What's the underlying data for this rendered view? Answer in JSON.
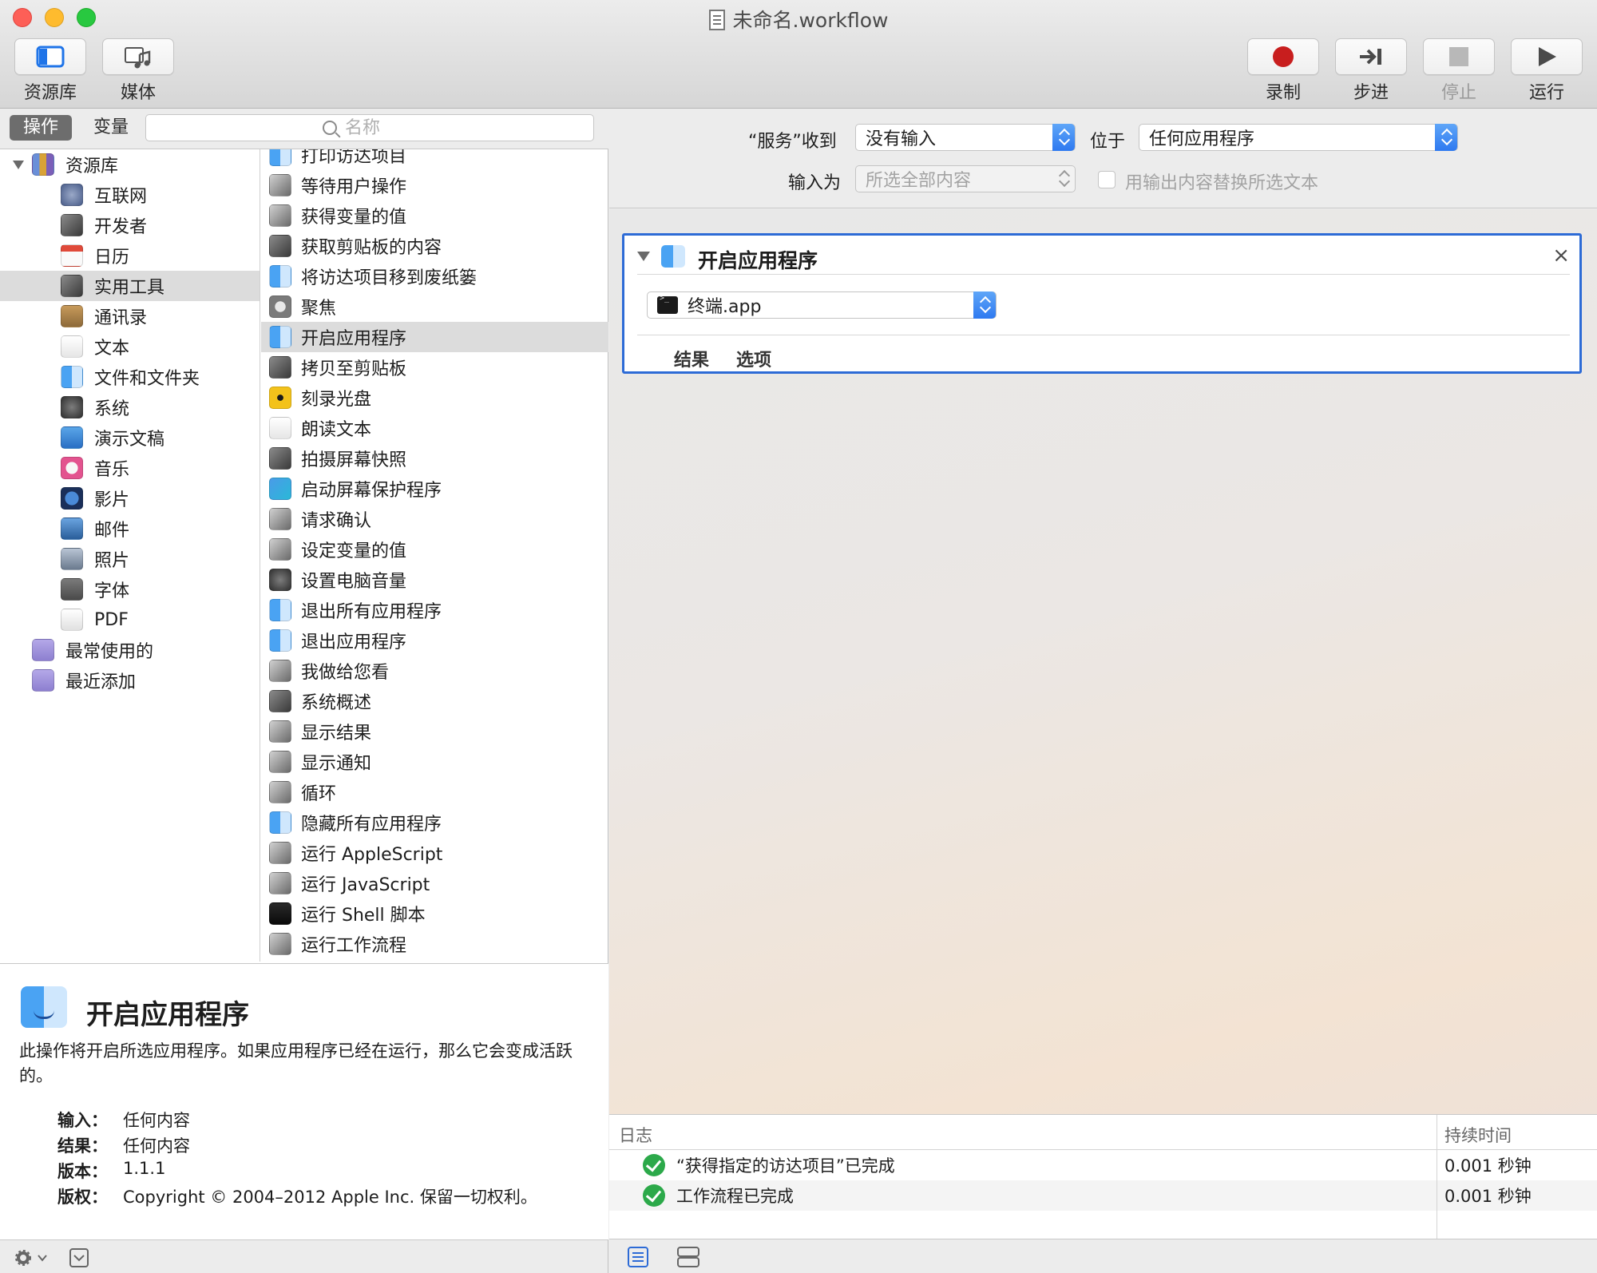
{
  "window": {
    "title": "未命名.workflow"
  },
  "toolbar": {
    "library_label": "资源库",
    "media_label": "媒体",
    "record_label": "录制",
    "step_label": "步进",
    "stop_label": "停止",
    "run_label": "运行"
  },
  "library": {
    "tab_actions": "操作",
    "tab_variables": "变量",
    "search_placeholder": "名称",
    "categories": [
      {
        "label": "资源库",
        "icon": "library-icon"
      },
      {
        "label": "互联网",
        "icon": "globe-icon"
      },
      {
        "label": "开发者",
        "icon": "tools-icon"
      },
      {
        "label": "日历",
        "icon": "calendar-icon"
      },
      {
        "label": "实用工具",
        "icon": "tools-icon"
      },
      {
        "label": "通讯录",
        "icon": "contacts-icon"
      },
      {
        "label": "文本",
        "icon": "text-icon"
      },
      {
        "label": "文件和文件夹",
        "icon": "finder-icon"
      },
      {
        "label": "系统",
        "icon": "system-icon"
      },
      {
        "label": "演示文稿",
        "icon": "keynote-icon"
      },
      {
        "label": "音乐",
        "icon": "music-icon"
      },
      {
        "label": "影片",
        "icon": "quicktime-icon"
      },
      {
        "label": "邮件",
        "icon": "mail-icon"
      },
      {
        "label": "照片",
        "icon": "photos-icon"
      },
      {
        "label": "字体",
        "icon": "font-icon"
      },
      {
        "label": "PDF",
        "icon": "pdf-icon"
      },
      {
        "label": "最常使用的",
        "icon": "smart-folder-icon"
      },
      {
        "label": "最近添加",
        "icon": "smart-folder-icon"
      }
    ],
    "actions": [
      {
        "label": "打印访达项目",
        "icon": "finder-icon"
      },
      {
        "label": "等待用户操作",
        "icon": "automator-icon"
      },
      {
        "label": "获得变量的值",
        "icon": "automator-icon"
      },
      {
        "label": "获取剪贴板的内容",
        "icon": "tools-icon"
      },
      {
        "label": "将访达项目移到废纸篓",
        "icon": "finder-icon"
      },
      {
        "label": "聚焦",
        "icon": "spotlight-icon"
      },
      {
        "label": "开启应用程序",
        "icon": "finder-icon"
      },
      {
        "label": "拷贝至剪贴板",
        "icon": "tools-icon"
      },
      {
        "label": "刻录光盘",
        "icon": "burn-icon"
      },
      {
        "label": "朗读文本",
        "icon": "text-icon"
      },
      {
        "label": "拍摄屏幕快照",
        "icon": "tools-icon"
      },
      {
        "label": "启动屏幕保护程序",
        "icon": "screensaver-icon"
      },
      {
        "label": "请求确认",
        "icon": "automator-icon"
      },
      {
        "label": "设定变量的值",
        "icon": "automator-icon"
      },
      {
        "label": "设置电脑音量",
        "icon": "system-icon"
      },
      {
        "label": "退出所有应用程序",
        "icon": "finder-icon"
      },
      {
        "label": "退出应用程序",
        "icon": "finder-icon"
      },
      {
        "label": "我做给您看",
        "icon": "automator-icon"
      },
      {
        "label": "系统概述",
        "icon": "tools-icon"
      },
      {
        "label": "显示结果",
        "icon": "automator-icon"
      },
      {
        "label": "显示通知",
        "icon": "automator-icon"
      },
      {
        "label": "循环",
        "icon": "automator-icon"
      },
      {
        "label": "隐藏所有应用程序",
        "icon": "finder-icon"
      },
      {
        "label": "运行 AppleScript",
        "icon": "automator-icon"
      },
      {
        "label": "运行 JavaScript",
        "icon": "automator-icon"
      },
      {
        "label": "运行 Shell 脚本",
        "icon": "terminal-icon"
      },
      {
        "label": "运行工作流程",
        "icon": "automator-icon"
      }
    ],
    "selected_category_index": 4,
    "selected_action_index": 6
  },
  "description": {
    "title": "开启应用程序",
    "text": "此操作将开启所选应用程序。如果应用程序已经在运行，那么它会变成活跃的。",
    "input_key": "输入：",
    "input_value": "任何内容",
    "result_key": "结果：",
    "result_value": "任何内容",
    "version_key": "版本：",
    "version_value": "1.1.1",
    "copyright_key": "版权：",
    "copyright_value": "Copyright © 2004–2012 Apple Inc. 保留一切权利。"
  },
  "workflow_settings": {
    "receives_label": "“服务”收到",
    "receives_value": "没有输入",
    "in_label": "位于",
    "in_value": "任何应用程序",
    "input_is_label": "输入为",
    "input_is_value": "所选全部内容",
    "replace_label": "用输出内容替换所选文本"
  },
  "action_card": {
    "title": "开启应用程序",
    "close": "×",
    "app_value": "终端.app",
    "tab_results": "结果",
    "tab_options": "选项"
  },
  "log": {
    "col_log": "日志",
    "col_duration": "持续时间",
    "rows": [
      {
        "message": "“获得指定的访达项目”已完成",
        "duration": "0.001 秒钟"
      },
      {
        "message": "工作流程已完成",
        "duration": "0.001 秒钟"
      }
    ]
  },
  "colors": {
    "accent": "#2d6bd6",
    "record": "#c81e1e",
    "success": "#2ca94a"
  }
}
